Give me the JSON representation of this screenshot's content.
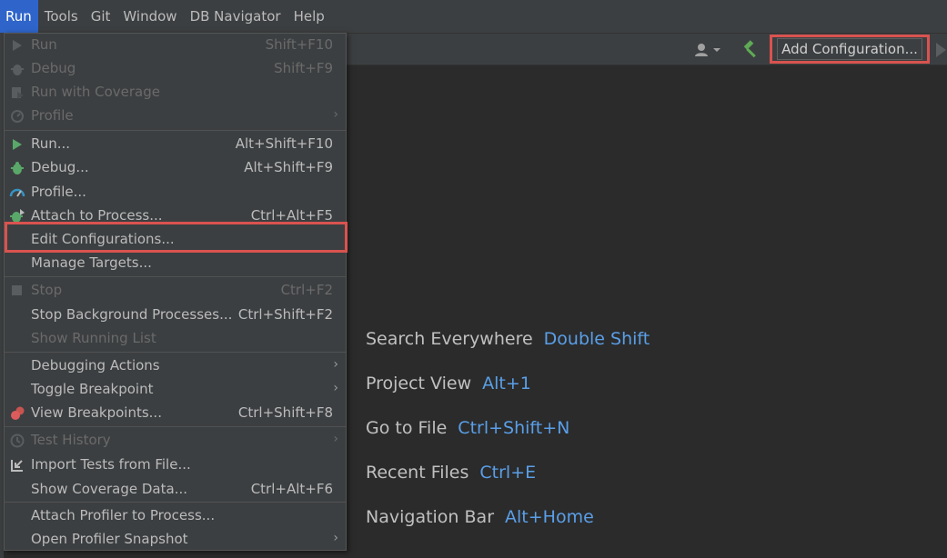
{
  "menubar": {
    "items": [
      {
        "label": "Run",
        "active": true
      },
      {
        "label": "Tools"
      },
      {
        "label": "Git"
      },
      {
        "label": "Window"
      },
      {
        "label": "DB Navigator"
      },
      {
        "label": "Help"
      }
    ]
  },
  "toolbar": {
    "add_configuration_label": "Add Configuration...",
    "highlight_color": "#d9534f"
  },
  "run_menu": {
    "items": [
      {
        "label": "Run",
        "shortcut": "Shift+F10",
        "icon": "run-icon",
        "disabled": true
      },
      {
        "label": "Debug",
        "shortcut": "Shift+F9",
        "icon": "debug-icon",
        "disabled": true
      },
      {
        "label": "Run with Coverage",
        "shortcut": "",
        "icon": "coverage-icon",
        "disabled": true
      },
      {
        "label": "Profile",
        "shortcut": "",
        "icon": "profile-icon",
        "disabled": true,
        "submenu": true
      },
      {
        "label": "Run...",
        "shortcut": "Alt+Shift+F10",
        "icon": "run-icon"
      },
      {
        "label": "Debug...",
        "shortcut": "Alt+Shift+F9",
        "icon": "debug-icon"
      },
      {
        "label": "Profile...",
        "shortcut": "",
        "icon": "profiler-gauge-icon"
      },
      {
        "label": "Attach to Process...",
        "shortcut": "Ctrl+Alt+F5",
        "icon": "attach-debug-icon"
      },
      {
        "label": "Edit Configurations...",
        "shortcut": "",
        "highlighted": true
      },
      {
        "label": "Manage Targets...",
        "shortcut": ""
      },
      {
        "label": "Stop",
        "shortcut": "Ctrl+F2",
        "icon": "stop-icon",
        "disabled": true
      },
      {
        "label": "Stop Background Processes...",
        "shortcut": "Ctrl+Shift+F2"
      },
      {
        "label": "Show Running List",
        "shortcut": "",
        "disabled": true
      },
      {
        "label": "Debugging Actions",
        "shortcut": "",
        "submenu": true
      },
      {
        "label": "Toggle Breakpoint",
        "shortcut": "",
        "submenu": true
      },
      {
        "label": "View Breakpoints...",
        "shortcut": "Ctrl+Shift+F8",
        "icon": "breakpoints-icon"
      },
      {
        "label": "Test History",
        "shortcut": "",
        "icon": "history-icon",
        "disabled": true,
        "submenu": true
      },
      {
        "label": "Import Tests from File...",
        "shortcut": "",
        "icon": "import-icon"
      },
      {
        "label": "Show Coverage Data...",
        "shortcut": "Ctrl+Alt+F6"
      },
      {
        "label": "Attach Profiler to Process...",
        "shortcut": ""
      },
      {
        "label": "Open Profiler Snapshot",
        "shortcut": "",
        "submenu": true
      }
    ]
  },
  "editor_hints": [
    {
      "label": "Search Everywhere",
      "key": "Double Shift"
    },
    {
      "label": "Project View",
      "key": "Alt+1"
    },
    {
      "label": "Go to File",
      "key": "Ctrl+Shift+N"
    },
    {
      "label": "Recent Files",
      "key": "Ctrl+E"
    },
    {
      "label": "Navigation Bar",
      "key": "Alt+Home"
    }
  ]
}
